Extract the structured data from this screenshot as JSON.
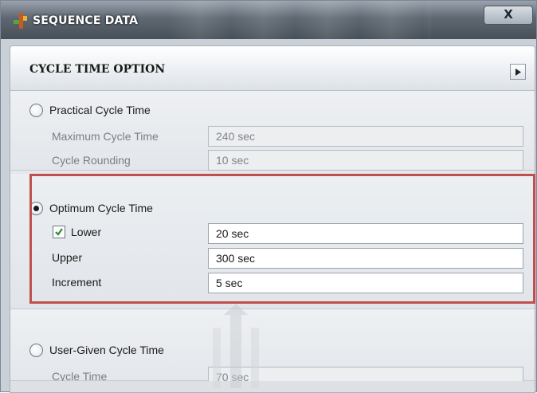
{
  "window": {
    "title": "SEQUENCE DATA",
    "close_label": "X"
  },
  "panel": {
    "title": "CYCLE TIME OPTION"
  },
  "practical": {
    "label": "Practical Cycle Time",
    "selected": false,
    "max_label": "Maximum Cycle Time",
    "max_value": "240 sec",
    "rounding_label": "Cycle Rounding",
    "rounding_value": "10 sec"
  },
  "optimum": {
    "label": "Optimum Cycle Time",
    "selected": true,
    "lower_label": "Lower",
    "lower_checked": true,
    "lower_value": "20 sec",
    "upper_label": "Upper",
    "upper_value": "300 sec",
    "increment_label": "Increment",
    "increment_value": "5 sec"
  },
  "user_given": {
    "label": "User-Given Cycle Time",
    "selected": false,
    "cycle_label": "Cycle Time",
    "cycle_value": "70 sec"
  },
  "colors": {
    "highlight": "#c0504d",
    "titlebar": "#474f58",
    "panel_bg": "#e4e7eb"
  }
}
